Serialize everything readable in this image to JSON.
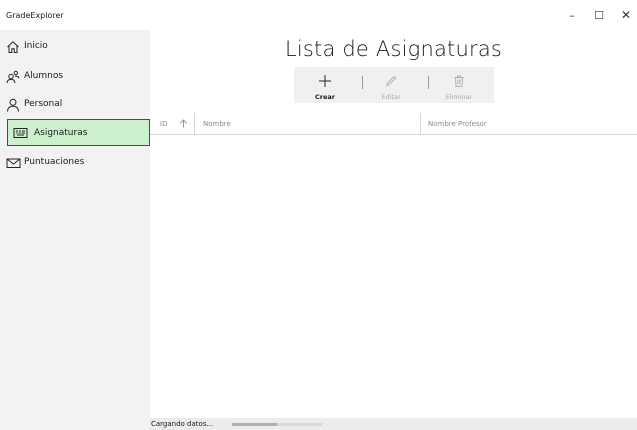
{
  "window": {
    "title": "GradeExplorer",
    "controls": {
      "minimize": "–",
      "maximize": "☐",
      "close": "✕"
    }
  },
  "sidebar": {
    "items": [
      {
        "label": "Inicio",
        "icon": "home-icon",
        "selected": false
      },
      {
        "label": "Alumnos",
        "icon": "people-icon",
        "selected": false
      },
      {
        "label": "Personal",
        "icon": "person-icon",
        "selected": false
      },
      {
        "label": "Asignaturas",
        "icon": "keyboard-icon",
        "selected": true
      },
      {
        "label": "Puntuaciones",
        "icon": "mail-icon",
        "selected": false
      }
    ],
    "selected_color": "#ccf0cc"
  },
  "main": {
    "title": "Lista de Asignaturas",
    "commands": {
      "crear": {
        "label": "Crear",
        "icon": "plus-icon",
        "enabled": true
      },
      "editar": {
        "label": "Editar",
        "icon": "pencil-icon",
        "enabled": false
      },
      "eliminar": {
        "label": "Eliminar",
        "icon": "trash-icon",
        "enabled": false
      }
    },
    "table": {
      "columns": [
        "ID",
        "Nombre",
        "Nombre Profesor"
      ],
      "sort_icon": "arrow-up-icon",
      "rows": []
    }
  },
  "status": {
    "text": "Cargando datos...",
    "progress": 0.5
  }
}
